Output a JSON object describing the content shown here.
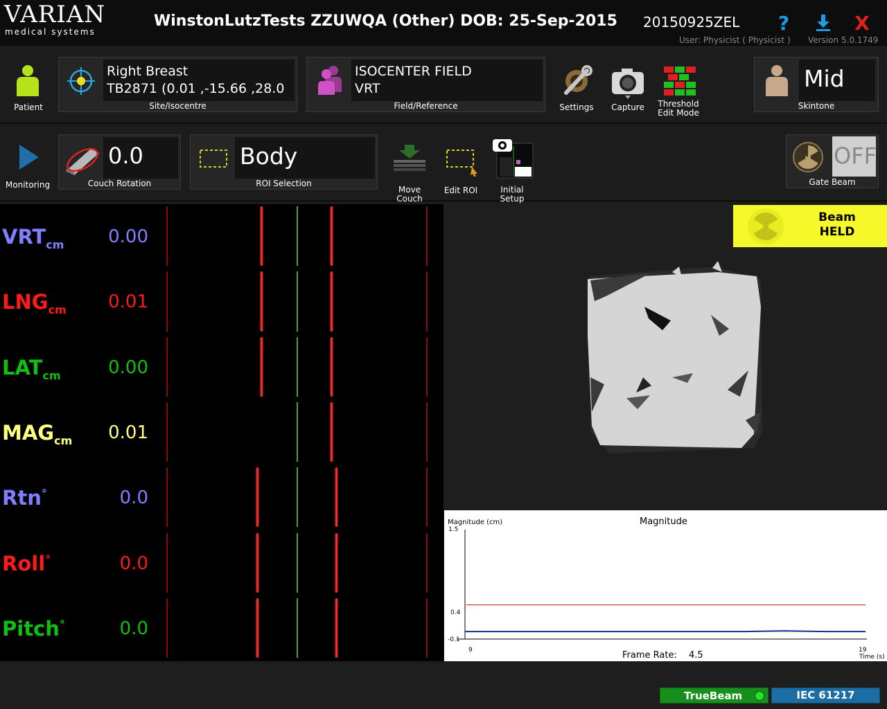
{
  "header": {
    "logo_main": "VARIAN",
    "logo_sub": "medical systems",
    "patient_title": "WinstonLutzTests ZZUWQA (Other) DOB: 25-Sep-2015",
    "patient_id": "20150925ZEL",
    "user": "User: Physicist  ( Physicist )",
    "version": "Version 5.0.1749",
    "help": "?",
    "close": "X"
  },
  "toolbar1": {
    "patient_label": "Patient",
    "site_name": "Right Breast",
    "site_coords": "TB2871 (0.01 ,-15.66 ,28.0",
    "site_label": "Site/Isocentre",
    "field_name": "ISOCENTER FIELD",
    "field_ref": "VRT",
    "field_label": "Field/Reference",
    "settings_label": "Settings",
    "capture_label": "Capture",
    "threshold_label_1": "Threshold",
    "threshold_label_2": "Edit Mode",
    "skintone_value": "Mid",
    "skintone_label": "Skintone"
  },
  "toolbar2": {
    "monitoring_label": "Monitoring",
    "couch_rotation_value": "0.0",
    "couch_rotation_label": "Couch Rotation",
    "roi_value": "Body",
    "roi_label": "ROI Selection",
    "move_couch_label_1": "Move",
    "move_couch_label_2": "Couch",
    "edit_roi_label": "Edit ROI",
    "initial_setup_label_1": "Initial",
    "initial_setup_label_2": "Setup",
    "gate_value": "OFF",
    "gate_label": "Gate Beam"
  },
  "colors": {
    "blue": "#8080ff",
    "red": "#ff1a1a",
    "green": "#10c010",
    "yellow": "#ffff80"
  },
  "metrics": [
    {
      "name": "VRT",
      "unit": "cm",
      "value": "0.00",
      "color": "#8080ff"
    },
    {
      "name": "LNG",
      "unit": "cm",
      "value": "0.01",
      "color": "#ff1a1a"
    },
    {
      "name": "LAT",
      "unit": "cm",
      "value": "0.00",
      "color": "#10c010"
    },
    {
      "name": "MAG",
      "unit": "cm",
      "value": "0.01",
      "color": "#ffff80"
    },
    {
      "name": "Rtn",
      "unit": "°",
      "value": "0.0",
      "color": "#8080ff"
    },
    {
      "name": "Roll",
      "unit": "°",
      "value": "0.0",
      "color": "#ff1a1a"
    },
    {
      "name": "Pitch",
      "unit": "°",
      "value": "0.0",
      "color": "#10c010"
    }
  ],
  "beam": {
    "line1": "Beam",
    "line2": "HELD"
  },
  "graph": {
    "ylabel": "Magnitude (cm)",
    "title": "Magnitude",
    "y_max": "1.5",
    "y_threshold": "0.4",
    "y_min": "-0.1",
    "x_start": "9",
    "x_end": "19",
    "x_unit": "Time (s)",
    "frame_rate_label": "Frame Rate:",
    "frame_rate_value": "4.5"
  },
  "chart_data": {
    "type": "line",
    "title": "Magnitude",
    "ylabel": "Magnitude (cm)",
    "xlabel": "Time (s)",
    "xlim": [
      9,
      19
    ],
    "ylim": [
      -0.1,
      1.5
    ],
    "threshold": 0.4,
    "series": [
      {
        "values_x": [
          9,
          10,
          11,
          12,
          13,
          14,
          15,
          16,
          17,
          18,
          19
        ],
        "values_y": [
          0.01,
          0.01,
          0.01,
          0.01,
          0.01,
          0.01,
          0.01,
          0.01,
          0.02,
          0.01,
          0.01
        ]
      }
    ]
  },
  "status": {
    "truebeam": "TrueBeam",
    "iec": "IEC 61217"
  }
}
